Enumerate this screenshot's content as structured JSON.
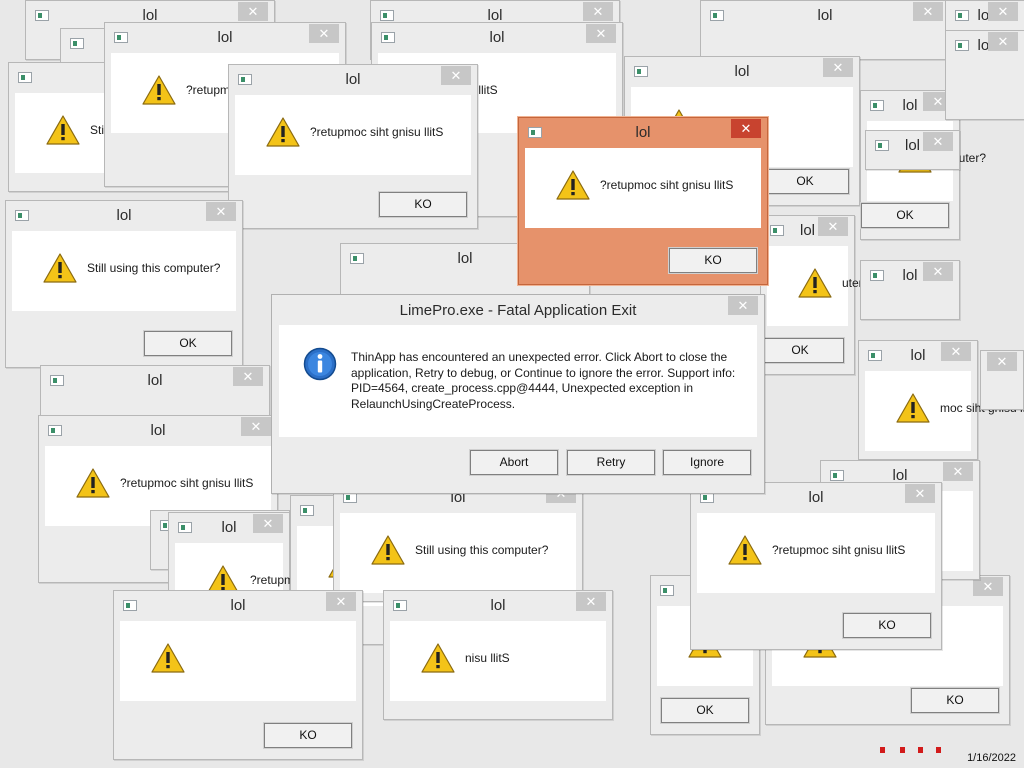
{
  "title_text": "lol",
  "warning_message_reversed": "?retupmoc siht gnisu llitS",
  "warning_message": "Still using this computer?",
  "button_ok": "OK",
  "button_ko": "KO",
  "fatal_dialog": {
    "title": "LimePro.exe - Fatal Application Exit",
    "message": "ThinApp has encountered an unexpected error. Click Abort to close the application, Retry to debug, or Continue to ignore the error. Support info: PID=4564, create_process.cpp@4444, Unexpected exception in RelaunchUsingCreateProcess.",
    "buttons": [
      "Abort",
      "Retry",
      "Ignore"
    ]
  },
  "clock": "1/16/2022",
  "colors": {
    "active_frame": "#e6926b",
    "active_close": "#c8432f",
    "inactive_frame": "#ececec",
    "close_button": "#c7c7c7",
    "warning_yellow": "#f3c318",
    "info_blue": "#1f6fd0"
  }
}
